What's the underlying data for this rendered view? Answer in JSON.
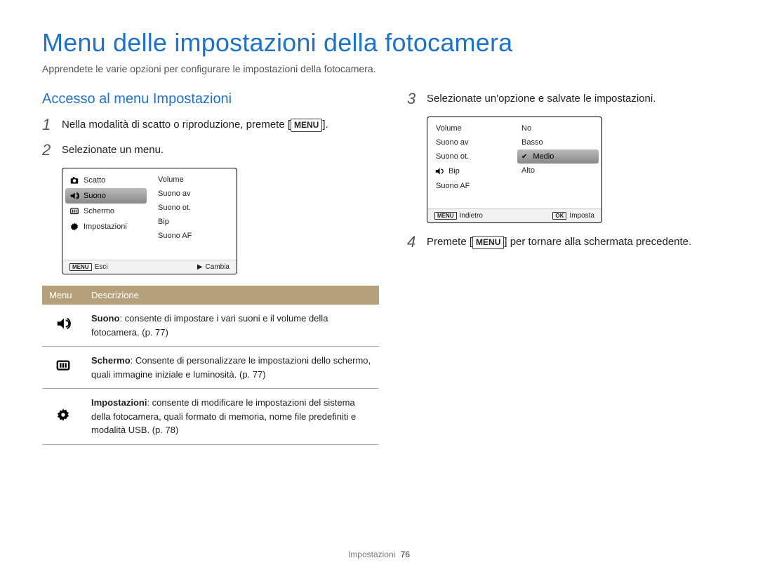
{
  "title": "Menu delle impostazioni della fotocamera",
  "intro": "Apprendete le varie opzioni per configurare le impostazioni della fotocamera.",
  "section_title": "Accesso al menu Impostazioni",
  "steps": {
    "s1a": "Nella modalità di scatto o riproduzione, premete [",
    "s1b": "].",
    "menu_word": "MENU",
    "s2": "Selezionate un menu.",
    "s3": "Selezionate un'opzione e salvate le impostazioni.",
    "s4a": "Premete [",
    "s4b": "] per tornare alla schermata precedente."
  },
  "screen1": {
    "left": [
      "Scatto",
      "Suono",
      "Schermo",
      "Impostazioni"
    ],
    "right": [
      "Volume",
      "Suono av",
      "Suono ot.",
      "Bip",
      "Suono AF"
    ],
    "footer_left": "Esci",
    "footer_right": "Cambia"
  },
  "screen2": {
    "left": [
      "Volume",
      "Suono av",
      "Suono ot.",
      "Bip",
      "Suono AF"
    ],
    "right": [
      "No",
      "Basso",
      "Medio",
      "Alto"
    ],
    "footer_left": "Indietro",
    "footer_right": "Imposta"
  },
  "table": {
    "header_menu": "Menu",
    "header_desc": "Descrizione",
    "rows": [
      {
        "label": "Suono",
        "text": ": consente di impostare i vari suoni e il volume della fotocamera. (p. 77)"
      },
      {
        "label": "Schermo",
        "text": ": Consente di personalizzare le impostazioni dello schermo, quali immagine iniziale e luminosità. (p. 77)"
      },
      {
        "label": "Impostazioni",
        "text": ": consente di modificare le impostazioni del sistema della fotocamera, quali formato di memoria, nome file predefiniti e modalità USB. (p. 78)"
      }
    ]
  },
  "footer": {
    "section": "Impostazioni",
    "page": "76"
  }
}
